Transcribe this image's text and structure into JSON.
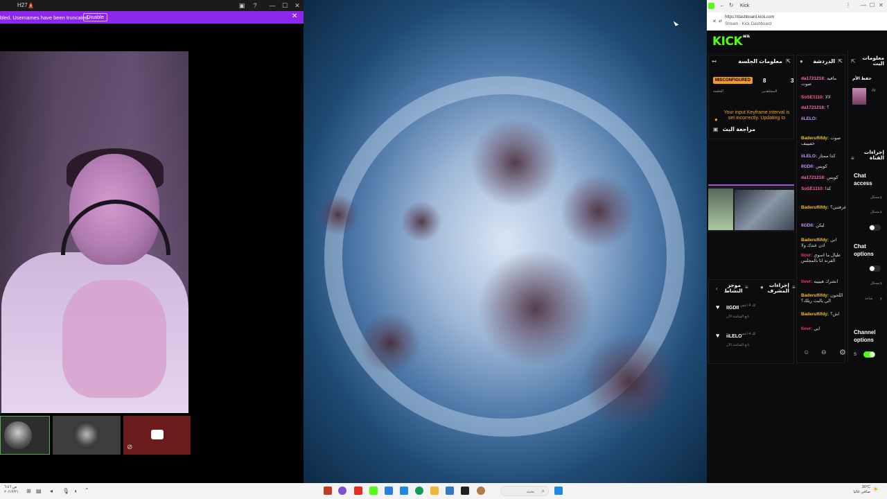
{
  "left_window": {
    "title": "H27🛕",
    "banner": {
      "text": "bled. Usernames have been truncated.",
      "disable_label": "Disable"
    }
  },
  "taskbar": {
    "left_time": "ص ٦:٤٦",
    "left_date": "٢٠/١٢/٢١",
    "search_placeholder": "بحث",
    "weather_temp": "30°C",
    "weather_desc": "صافي غالبا"
  },
  "browser": {
    "tab_title": "Kick",
    "url": "https://dashboard.kick.com",
    "page_title": "Stream - Kick Dashboard"
  },
  "kick": {
    "logo": "KICK",
    "logo_badge": "BETA",
    "session_panel": {
      "title": "معلومات الجلسة",
      "badge": "MISCONFIGURED",
      "badge_caption": "الجلسة",
      "viewers_value": "8",
      "viewers_label": "المشاهدين",
      "third_value": "3",
      "warning": "Your input Keyframe interval is set incorrectly. Updating to",
      "review_label": "مراجعة البث"
    },
    "chat_panel": {
      "title": "الدردشة",
      "messages": [
        {
          "user": "da1721218:",
          "text": "مافيه صوت",
          "color": "#ff69b4"
        },
        {
          "user": "SoSE1110:",
          "text": "لالا",
          "color": "#ff5c93"
        },
        {
          "user": "da1721218:",
          "text": "؟",
          "color": "#ff69b4"
        },
        {
          "user": "iiLELO:",
          "text": "",
          "color": "#c994ff"
        },
        {
          "user": "Baderuflifdy:",
          "text": "صوت خفيييف",
          "color": "#f1c40f"
        },
        {
          "user": "iiLELO:",
          "text": "كذا ممتاز",
          "color": "#c994ff"
        },
        {
          "user": "IIGDII:",
          "text": "كويس",
          "color": "#c994ff"
        },
        {
          "user": "da1721218:",
          "text": "كويس",
          "color": "#ff69b4"
        },
        {
          "user": "SoSE1110:",
          "text": "كذا",
          "color": "#ff5c93"
        },
        {
          "user": "Baderuflifdy:",
          "text": "عرفتني؟",
          "color": "#f1c40f"
        },
        {
          "user": "IIGDII:",
          "text": "ليكن",
          "color": "#c994ff"
        },
        {
          "user": "Baderuflifdy:",
          "text": "اني اذن عندك ولا",
          "color": "#f1c40f"
        },
        {
          "user": "tiovr:",
          "text": "طيال ما اسوي الفرند انا بالمجلس",
          "color": "#ff3b6b"
        },
        {
          "user": "tiovr:",
          "text": "انشرك هييييه",
          "color": "#ff3b6b"
        },
        {
          "user": "Baderuflifdy:",
          "text": "اللحون الي بالبث ريلك؟",
          "color": "#f1c40f"
        },
        {
          "user": "Baderuflifdy:",
          "text": "اش؟",
          "color": "#f1c40f"
        },
        {
          "user": "tiovr:",
          "text": "ايي",
          "color": "#ff3b6b"
        }
      ]
    },
    "mod_panel": {
      "col1_title": "موجز النشاط",
      "col2_title": "إجراءات المشرف",
      "rows": [
        {
          "user": "IIGDII",
          "meta": "لك 4 اعفي",
          "meta2": "تابع الشاشة الآن"
        },
        {
          "user": "iiLELO",
          "meta": "لك 4 اعفي",
          "meta2": "تابع الشاشة الآن"
        }
      ]
    },
    "side_panel": {
      "top_title": "معلومات البث",
      "top_sub": "حفظ الأم",
      "actions_title": "إجراءات القناة",
      "chat_access": "Chat access",
      "chat_options": "Chat options",
      "channel_options": "Channel options",
      "row_label": "مسكل",
      "row_label2": "مسكل",
      "row_label3": "مسكل",
      "row_label4": "مسكل",
      "row_label5": "شاحذ",
      "ar_label": "Ar",
      "s_label": "S"
    }
  }
}
